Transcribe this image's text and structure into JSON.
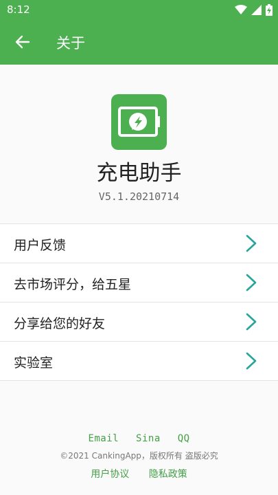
{
  "status": {
    "time": "8:12"
  },
  "appbar": {
    "title": "关于",
    "back_icon": "arrow-left-icon"
  },
  "app": {
    "name": "充电助手",
    "version": "V5.1.20210714",
    "brand_color": "#4caf50"
  },
  "menu": {
    "items": [
      {
        "label": "用户反馈"
      },
      {
        "label": "去市场评分，给五星"
      },
      {
        "label": "分享给您的好友"
      },
      {
        "label": "实验室"
      }
    ]
  },
  "footer": {
    "links": [
      "Email",
      "Sina",
      "QQ"
    ],
    "copyright": "©2021 CankingApp，版权所有 盗版必究",
    "legal": [
      "用户协议",
      "隐私政策"
    ],
    "link_color": "#43a047"
  }
}
